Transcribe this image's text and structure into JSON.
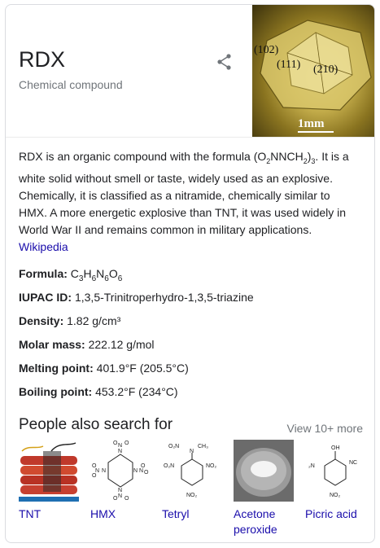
{
  "header": {
    "title": "RDX",
    "subtitle": "Chemical compound"
  },
  "image": {
    "labels": [
      "(102)",
      "(111)",
      "(210)"
    ],
    "scale_label": "1mm"
  },
  "description": {
    "text_before_formula": "RDX is an organic compound with the formula (O",
    "text_formula_mid": "NNCH",
    "text_after_formula": ". It is a white solid without smell or taste, widely used as an explosive. Chemically, it is classified as a nitramide, chemically similar to HMX. A more energetic explosive than TNT, it was used widely in World War II and remains common in military applications.",
    "sub1": "2",
    "sub2": "2",
    "sub3": "3",
    "source_link": "Wikipedia"
  },
  "facts": [
    {
      "label": "Formula:",
      "value": "C3H6N6O6"
    },
    {
      "label": "IUPAC ID:",
      "value": "1,3,5-Trinitroperhydro-1,3,5-triazine"
    },
    {
      "label": "Density:",
      "value": "1.82 g/cm³"
    },
    {
      "label": "Molar mass:",
      "value": "222.12 g/mol"
    },
    {
      "label": "Melting point:",
      "value": "401.9°F (205.5°C)"
    },
    {
      "label": "Boiling point:",
      "value": "453.2°F (234°C)"
    }
  ],
  "people_also_search": {
    "title": "People also search for",
    "view_more": "View 10+ more",
    "items": [
      {
        "name": "TNT"
      },
      {
        "name": "HMX"
      },
      {
        "name": "Tetryl"
      },
      {
        "name": "Acetone peroxide"
      },
      {
        "name": "Picric acid"
      }
    ]
  },
  "colors": {
    "link": "#1a0dab",
    "secondary_text": "#70757a",
    "border": "#dadce0"
  }
}
